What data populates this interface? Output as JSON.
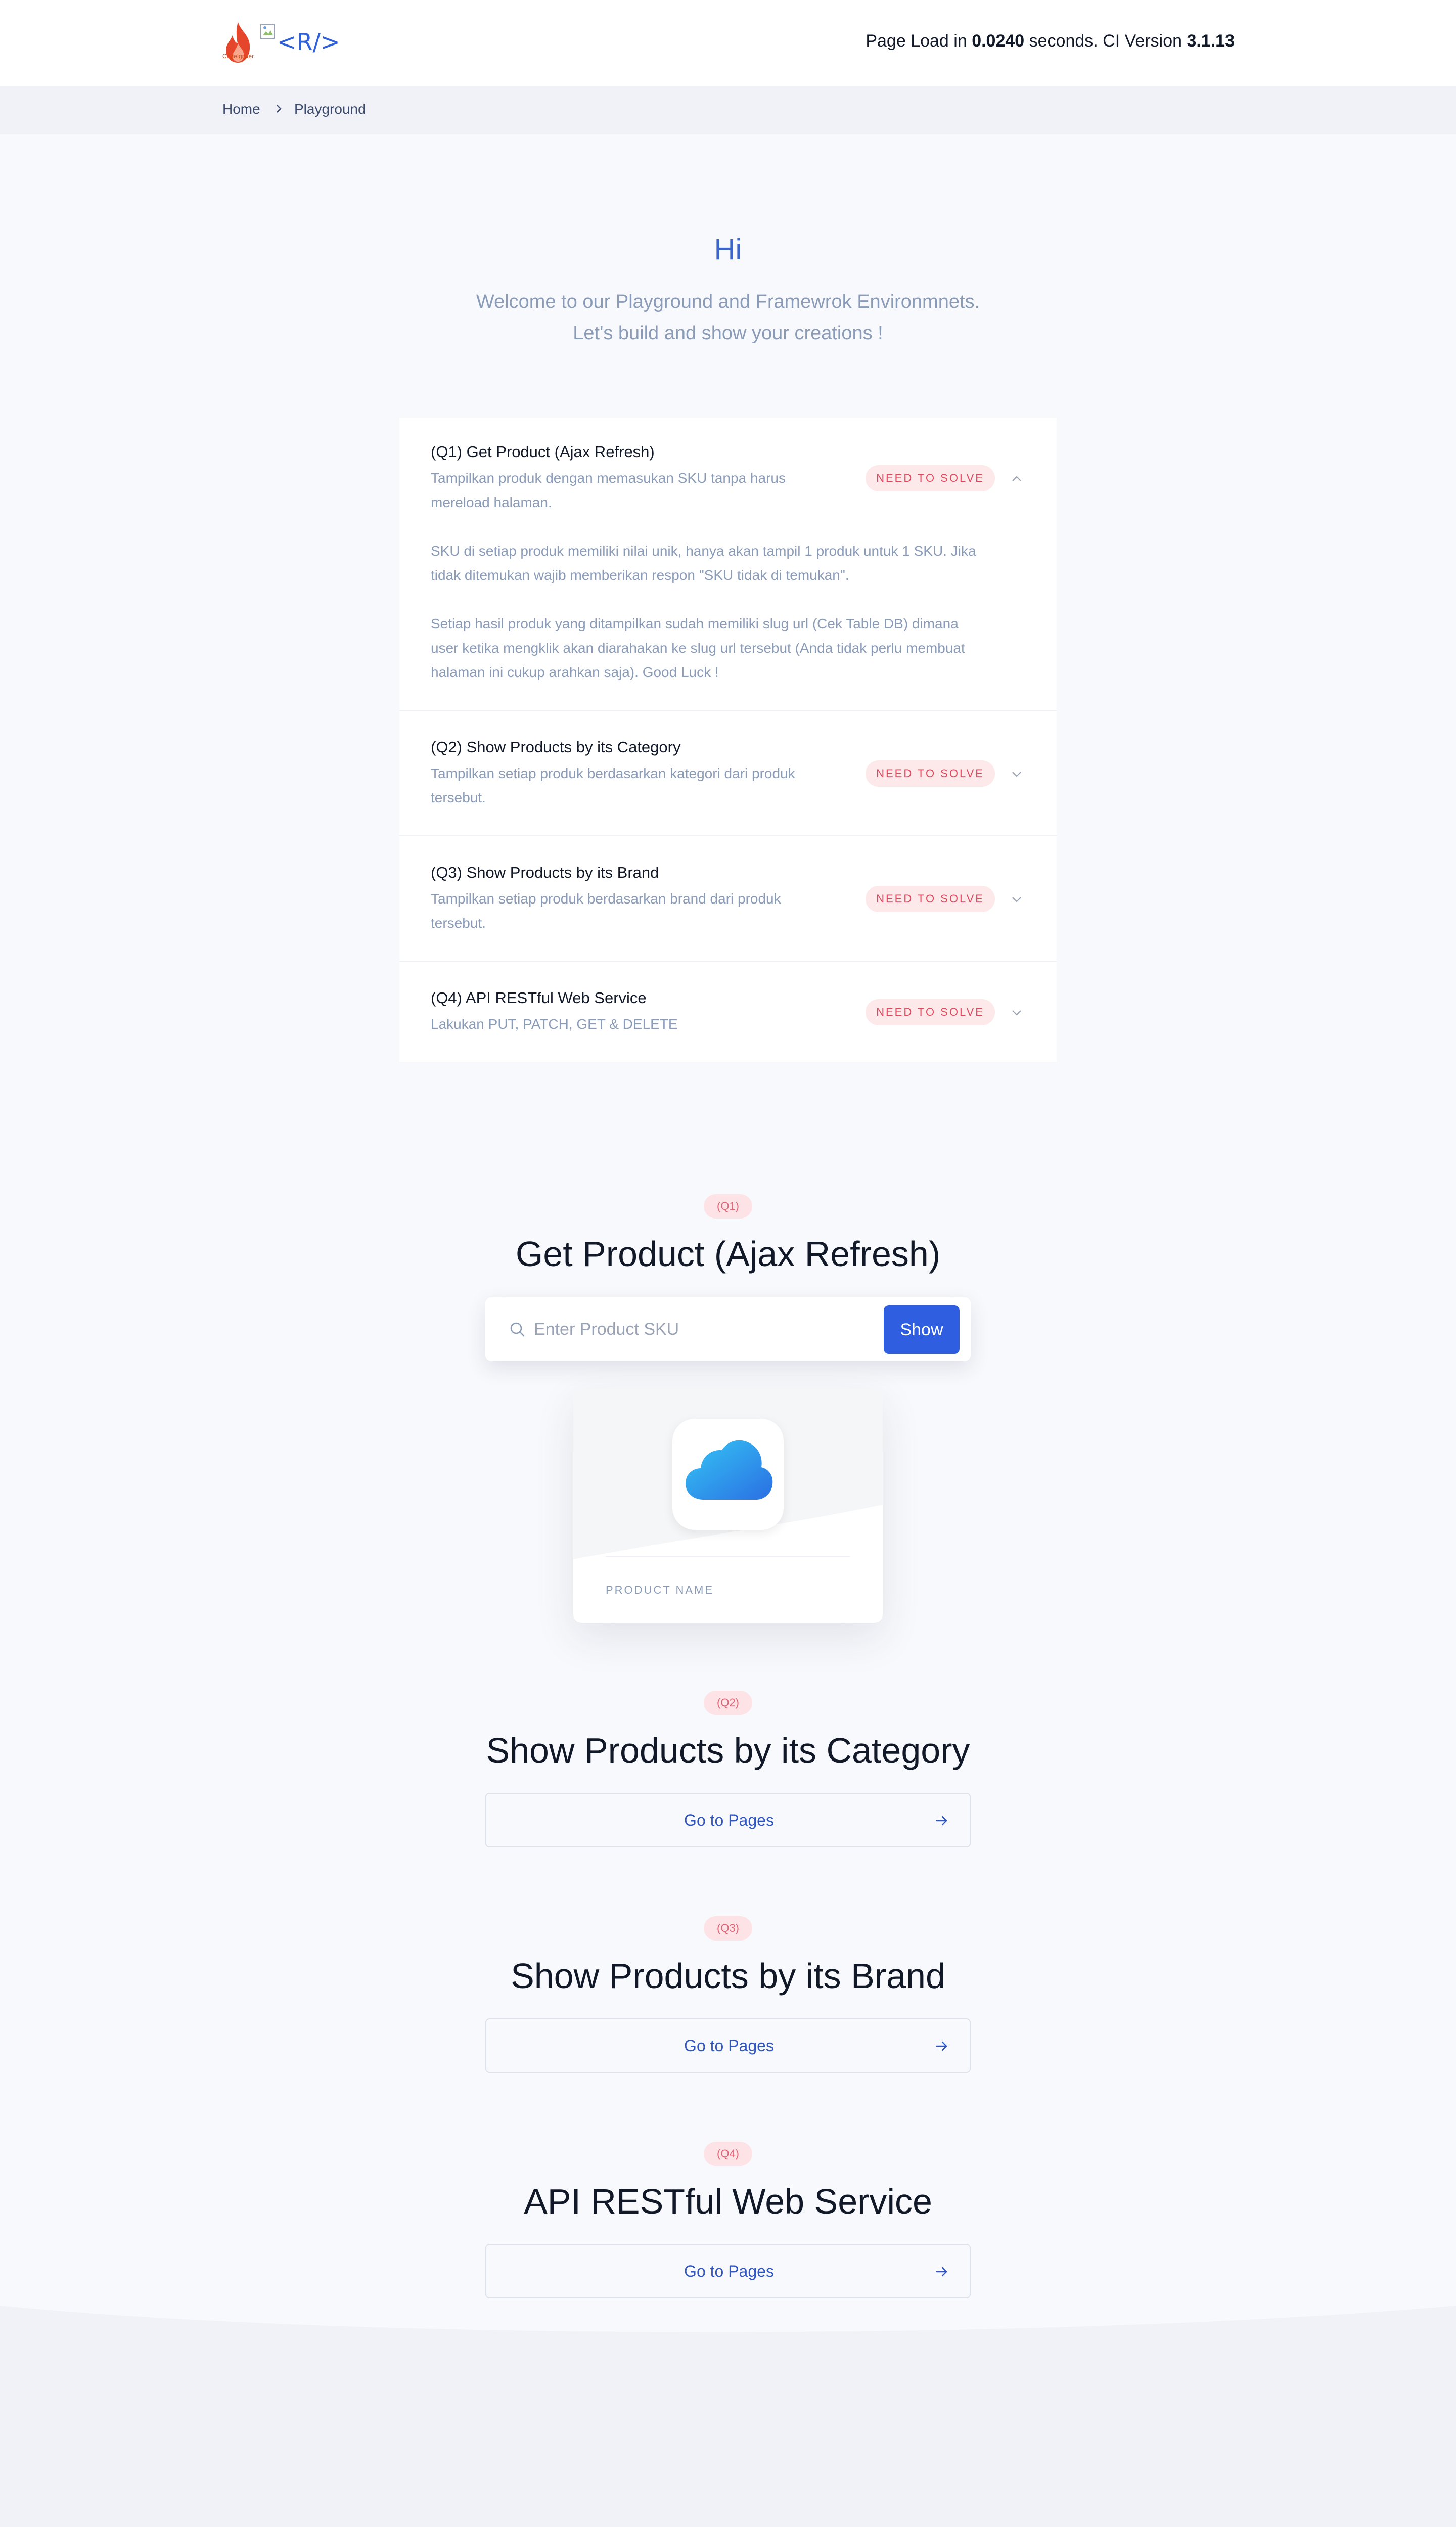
{
  "header": {
    "logo_text": "CodeIgniter",
    "brand": "<R/>",
    "page_load_prefix": "Page Load in ",
    "page_load_value": "0.0240",
    "page_load_middle": " seconds. CI Version ",
    "ci_version": "3.1.13"
  },
  "breadcrumb": {
    "home": "Home",
    "current": "Playground"
  },
  "hero": {
    "title": "Hi",
    "subtitle_line1": "Welcome to our Playground and Framewrok Environmnets.",
    "subtitle_line2": "Let's build and show your creations !"
  },
  "accordion": [
    {
      "title": "(Q1) Get Product (Ajax Refresh)",
      "desc_line1": "Tampilkan produk dengan memasukan SKU tanpa harus",
      "desc_line2": "mereload halaman.",
      "badge": "NEED TO SOLVE",
      "expanded": true,
      "body_p1_line1": "SKU di setiap produk memiliki nilai unik, hanya akan tampil 1 produk untuk 1 SKU. Jika",
      "body_p1_line2": "tidak ditemukan wajib memberikan respon \"SKU tidak di temukan\".",
      "body_p2_line1": "Setiap hasil produk yang ditampilkan sudah memiliki slug url (Cek Table DB) dimana",
      "body_p2_line2": "user ketika mengklik akan diarahakan ke slug url tersebut (Anda tidak perlu membuat",
      "body_p2_line3": "halaman ini cukup arahkan saja). Good Luck !"
    },
    {
      "title": "(Q2) Show Products by its Category",
      "desc_line1": "Tampilkan setiap produk berdasarkan kategori dari produk",
      "desc_line2": "tersebut.",
      "badge": "NEED TO SOLVE",
      "expanded": false
    },
    {
      "title": "(Q3) Show Products by its Brand",
      "desc_line1": "Tampilkan setiap produk berdasarkan brand dari produk",
      "desc_line2": "tersebut.",
      "badge": "NEED TO SOLVE",
      "expanded": false
    },
    {
      "title": "(Q4) API RESTful Web Service",
      "desc_line1": "Lakukan PUT, PATCH, GET & DELETE",
      "badge": "NEED TO SOLVE",
      "expanded": false
    }
  ],
  "sections": {
    "q1": {
      "tag": "(Q1)",
      "title": "Get Product (Ajax Refresh)",
      "search_placeholder": "Enter Product SKU",
      "search_value": "",
      "button": "Show",
      "card_icon": "cloud-icon",
      "card_label": "PRODUCT NAME"
    },
    "q2": {
      "tag": "(Q2)",
      "title": "Show Products by its Category",
      "button": "Go to Pages"
    },
    "q3": {
      "tag": "(Q3)",
      "title": "Show Products by its Brand",
      "button": "Go to Pages"
    },
    "q4": {
      "tag": "(Q4)",
      "title": "API RESTful Web Service",
      "button": "Go to Pages"
    }
  },
  "colors": {
    "accent": "#2f5fe0",
    "badge_bg": "#fde8ea",
    "badge_text": "#e0495d",
    "muted_text": "#8a9bb8",
    "page_bg": "#f8f9fc"
  }
}
